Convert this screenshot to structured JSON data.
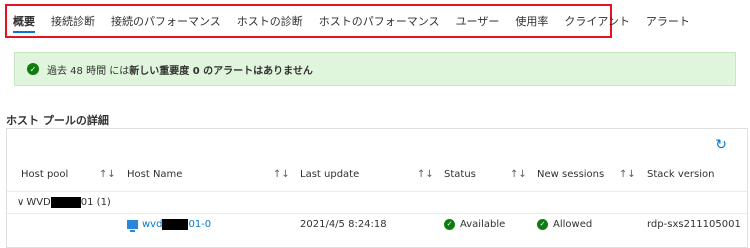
{
  "tabs": [
    {
      "label": "概要",
      "active": true
    },
    {
      "label": "接続診断"
    },
    {
      "label": "接続のパフォーマンス"
    },
    {
      "label": "ホストの診断"
    },
    {
      "label": "ホストのパフォーマンス"
    },
    {
      "label": "ユーザー"
    },
    {
      "label": "使用率"
    },
    {
      "label": "クライアント"
    },
    {
      "label": "アラート"
    }
  ],
  "banner": {
    "prefix": "過去 48 時間 には",
    "bold_text": "新しい重要度 0 のアラートはありません",
    "icon": "check-circle-icon"
  },
  "section_title": "ホスト プールの詳細",
  "grid": {
    "refresh_icon": "refresh-icon",
    "columns": [
      "Host pool",
      "Host Name",
      "Last update",
      "Status",
      "New sessions",
      "Stack version"
    ],
    "group": {
      "prefix": "WVD",
      "suffix": "01 (1)"
    },
    "row": {
      "host_prefix": "wvd",
      "host_suffix": "01-0",
      "last_update": "2021/4/5 8:24:18",
      "status": "Available",
      "new_sessions": "Allowed",
      "stack_version": "rdp-sxs211105001"
    }
  },
  "colors": {
    "accent": "#0078d4",
    "success": "#107c10",
    "banner_bg": "#dff6dd",
    "highlight_border": "#e81123"
  }
}
